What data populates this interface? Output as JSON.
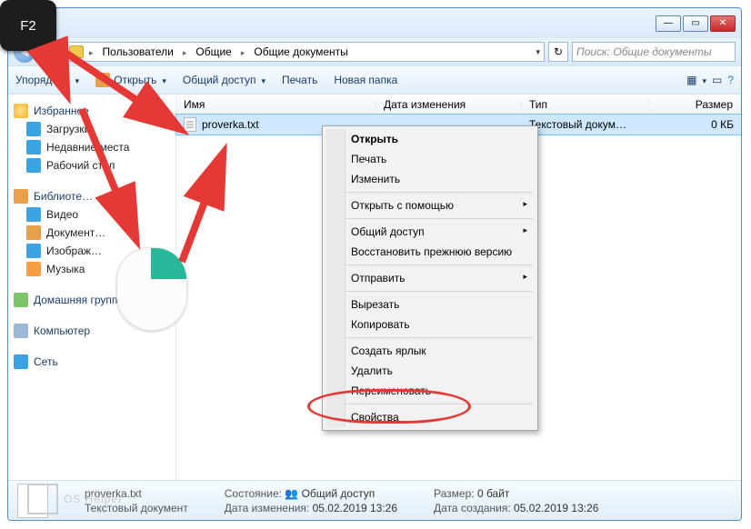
{
  "key_label": "F2",
  "breadcrumbs": [
    "Пользователи",
    "Общие",
    "Общие документы"
  ],
  "search_placeholder": "Поиск: Общие документы",
  "toolbar": {
    "organize": "Упорядочи",
    "open": "Открыть",
    "share": "Общий доступ",
    "print": "Печать",
    "new_folder": "Новая папка"
  },
  "sidebar": {
    "favorites": {
      "label": "Избранное",
      "items": [
        "Загрузки",
        "Недавние места",
        "Рабочий стол"
      ]
    },
    "libraries": {
      "label": "Библиоте…",
      "items": [
        "Видео",
        "Документ…",
        "Изображ…",
        "Музыка"
      ]
    },
    "homegroup": "Домашняя группа",
    "computer": "Компьютер",
    "network": "Сеть"
  },
  "columns": {
    "name": "Имя",
    "date": "Дата изменения",
    "type": "Тип",
    "size": "Размер"
  },
  "file": {
    "name": "proverka.txt",
    "type": "Текстовый докум…",
    "size": "0 КБ"
  },
  "context": {
    "open": "Открыть",
    "print": "Печать",
    "edit": "Изменить",
    "open_with": "Открыть с помощью",
    "share": "Общий доступ",
    "restore": "Восстановить прежнюю версию",
    "send_to": "Отправить",
    "cut": "Вырезать",
    "copy": "Копировать",
    "shortcut": "Создать ярлык",
    "delete": "Удалить",
    "rename": "Переименовать",
    "properties": "Свойства"
  },
  "status": {
    "filename": "proverka.txt",
    "filetype": "Текстовый документ",
    "state_label": "Состояние:",
    "state_value": "Общий доступ",
    "modified_label": "Дата изменения:",
    "modified_value": "05.02.2019 13:26",
    "size_label": "Размер:",
    "size_value": "0 байт",
    "created_label": "Дата создания:",
    "created_value": "05.02.2019 13:26"
  },
  "watermark": "OS Helper"
}
